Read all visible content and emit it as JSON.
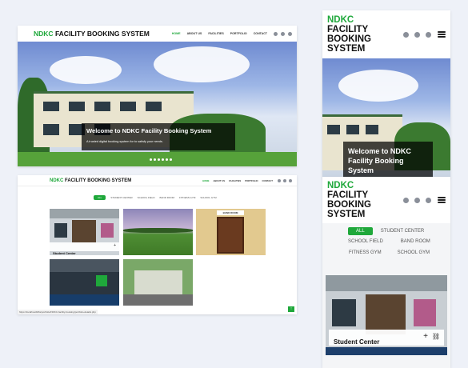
{
  "brand": {
    "prefix": "NDKC",
    "suffix": "FACILITY BOOKING SYSTEM",
    "mobile_lines": [
      "FACILITY",
      "BOOKING",
      "SYSTEM"
    ]
  },
  "nav": {
    "items": [
      "HOME",
      "ABOUT US",
      "FACILITIES",
      "PORTFOLIO",
      "CONTACT"
    ],
    "active": "HOME"
  },
  "social": [
    "twitter-icon",
    "facebook-icon",
    "instagram-icon"
  ],
  "hero": {
    "title": "Welcome to NDKC Facility Booking System",
    "subtitle": "A trusted digital booking system for to satisfy your needs.",
    "mobile_title_lines": [
      "Welcome to NDKC",
      "Facility Booking",
      "System"
    ]
  },
  "filters": [
    "ALL",
    "STUDENT CENTER",
    "SCHOOL FIELD",
    "BAND ROOM",
    "FITNESS GYM",
    "SCHOOL GYM"
  ],
  "filters_active": "ALL",
  "portfolio": [
    {
      "label": "Student Center"
    },
    {
      "label": ""
    },
    {
      "label": "BAND ROOM"
    },
    {
      "label": ""
    },
    {
      "label": ""
    }
  ],
  "status_url": "https://localhost/kfbs/portfolio/NDKC-facility-booking/portfolio-details.php",
  "mobile_card": {
    "label": "Student Center"
  },
  "colors": {
    "accent": "#1fa83b",
    "text": "#111111"
  }
}
